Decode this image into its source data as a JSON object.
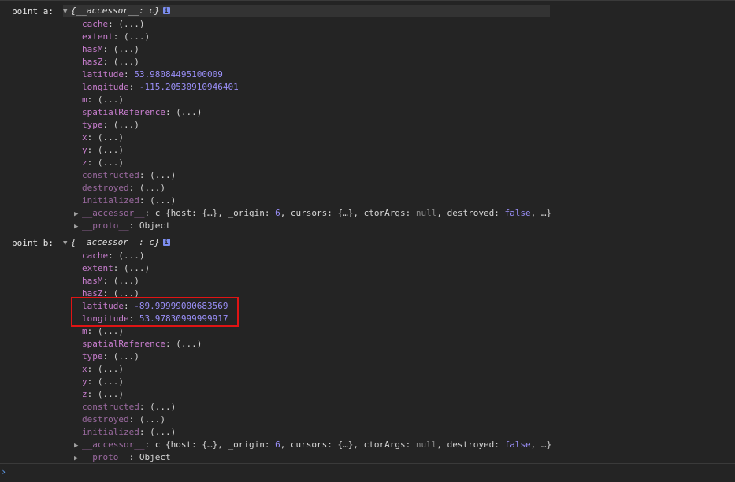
{
  "entries": [
    {
      "label": "point a:",
      "header": {
        "open_brace": "{",
        "object_name": "__accessor__: c",
        "close_brace": "}",
        "info_icon": "i"
      },
      "props": [
        {
          "key": "cache",
          "value": "(...)"
        },
        {
          "key": "extent",
          "value": "(...)"
        },
        {
          "key": "hasM",
          "value": "(...)"
        },
        {
          "key": "hasZ",
          "value": "(...)"
        },
        {
          "key": "latitude",
          "value": "53.98084495100009"
        },
        {
          "key": "longitude",
          "value": "-115.20530910946401"
        },
        {
          "key": "m",
          "value": "(...)"
        },
        {
          "key": "spatialReference",
          "value": "(...)"
        },
        {
          "key": "type",
          "value": "(...)"
        },
        {
          "key": "x",
          "value": "(...)"
        },
        {
          "key": "y",
          "value": "(...)"
        },
        {
          "key": "z",
          "value": "(...)"
        },
        {
          "key": "constructed",
          "value": "(...)"
        },
        {
          "key": "destroyed",
          "value": "(...)"
        },
        {
          "key": "initialized",
          "value": "(...)"
        }
      ],
      "accessor_row": {
        "key": "__accessor__",
        "cls": "c",
        "p1": "{host: {…}, _origin: ",
        "origin": "6",
        "p2": ", cursors: {…}, ctorArgs: ",
        "ctor": "null",
        "p3": ", destroyed: ",
        "destroyed": "false",
        "p4": ", …}"
      },
      "proto_row": {
        "key": "__proto__",
        "value": "Object"
      }
    },
    {
      "label": "point b:",
      "header": {
        "open_brace": "{",
        "object_name": "__accessor__: c",
        "close_brace": "}",
        "info_icon": "i"
      },
      "props": [
        {
          "key": "cache",
          "value": "(...)"
        },
        {
          "key": "extent",
          "value": "(...)"
        },
        {
          "key": "hasM",
          "value": "(...)"
        },
        {
          "key": "hasZ",
          "value": "(...)"
        },
        {
          "key": "latitude",
          "value": "-89.99999000683569"
        },
        {
          "key": "longitude",
          "value": "53.97830999999917"
        },
        {
          "key": "m",
          "value": "(...)"
        },
        {
          "key": "spatialReference",
          "value": "(...)"
        },
        {
          "key": "type",
          "value": "(...)"
        },
        {
          "key": "x",
          "value": "(...)"
        },
        {
          "key": "y",
          "value": "(...)"
        },
        {
          "key": "z",
          "value": "(...)"
        },
        {
          "key": "constructed",
          "value": "(...)"
        },
        {
          "key": "destroyed",
          "value": "(...)"
        },
        {
          "key": "initialized",
          "value": "(...)"
        }
      ],
      "accessor_row": {
        "key": "__accessor__",
        "cls": "c",
        "p1": "{host: {…}, _origin: ",
        "origin": "6",
        "p2": ", cursors: {…}, ctorArgs: ",
        "ctor": "null",
        "p3": ", destroyed: ",
        "destroyed": "false",
        "p4": ", …}"
      },
      "proto_row": {
        "key": "__proto__",
        "value": "Object"
      }
    }
  ],
  "prompt": "›",
  "colors": {
    "background": "#242424",
    "key": "#c97ecf",
    "number": "#9a8ff8",
    "highlight_box": "#e01414",
    "prompt": "#5f9ae8"
  }
}
